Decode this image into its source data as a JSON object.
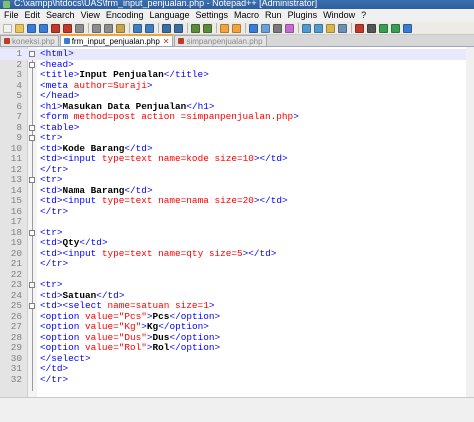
{
  "window": {
    "title": "C:\\xampp\\htdocs\\UAS\\frm_input_penjualan.php - Notepad++ [Administrator]"
  },
  "menu": [
    "File",
    "Edit",
    "Search",
    "View",
    "Encoding",
    "Language",
    "Settings",
    "Macro",
    "Run",
    "Plugins",
    "Window",
    "?"
  ],
  "toolbar": {
    "buttons": [
      "new-file-icon",
      "open-file-icon",
      "save-icon",
      "save-all-icon",
      "close-icon",
      "close-all-icon",
      "print-icon",
      "cut-icon",
      "copy-icon",
      "paste-icon",
      "undo-icon",
      "redo-icon",
      "find-icon",
      "replace-icon",
      "zoom-in-icon",
      "zoom-out-icon",
      "sync-v-icon",
      "sync-h-icon",
      "wrap-icon",
      "all-chars-icon",
      "indent-guide-icon",
      "udl-icon",
      "doc-map-icon",
      "function-list-icon",
      "folder-workspace-icon",
      "monitor-icon",
      "record-macro-icon",
      "stop-record-icon",
      "play-macro-icon",
      "run-macro-multiple-icon",
      "save-macro-icon"
    ],
    "colors": {
      "primary": "#3a7bd5",
      "accent": "#f2a33c",
      "danger": "#c0392b"
    }
  },
  "tabs": [
    {
      "label": "koneksi.php",
      "state": "inactive"
    },
    {
      "label": "frm_input_penjualan.php",
      "state": "active"
    },
    {
      "label": "simpanpenjualan.php",
      "state": "inactive"
    }
  ],
  "editor": {
    "current_line": 1,
    "lines": [
      {
        "n": "1",
        "code": "<html>"
      },
      {
        "n": "2",
        "code": "<head>"
      },
      {
        "n": "3",
        "code": "<title>Input Penjualan</title>"
      },
      {
        "n": "4",
        "code": "<meta author=Suraji>"
      },
      {
        "n": "5",
        "code": "</head>"
      },
      {
        "n": "6",
        "code": "<h1>Masukan Data Penjualan</h1>"
      },
      {
        "n": "7",
        "code": "<form method=post action =simpanpenjualan.php>"
      },
      {
        "n": "8",
        "code": "<table>"
      },
      {
        "n": "9",
        "code": "<tr>"
      },
      {
        "n": "10",
        "code": "<td>Kode Barang</td>"
      },
      {
        "n": "11",
        "code": "<td><input type=text name=kode size=10></td>"
      },
      {
        "n": "12",
        "code": "</tr>"
      },
      {
        "n": "13",
        "code": "<tr>"
      },
      {
        "n": "14",
        "code": "<td>Nama Barang</td>"
      },
      {
        "n": "15",
        "code": "<td><input type=text name=nama size=20></td>"
      },
      {
        "n": "16",
        "code": "</tr>"
      },
      {
        "n": "17",
        "code": ""
      },
      {
        "n": "18",
        "code": "<tr>"
      },
      {
        "n": "19",
        "code": "<td>Qty</td>"
      },
      {
        "n": "20",
        "code": "<td><input type=text name=qty size=5></td>"
      },
      {
        "n": "21",
        "code": "</tr>"
      },
      {
        "n": "22",
        "code": ""
      },
      {
        "n": "23",
        "code": "<tr>"
      },
      {
        "n": "24",
        "code": "<td>Satuan</td>"
      },
      {
        "n": "25",
        "code": "<td><select name=satuan size=1>"
      },
      {
        "n": "26",
        "code": "<option value=\"Pcs\">Pcs</option>"
      },
      {
        "n": "27",
        "code": "<option value=\"Kg\">Kg</option>"
      },
      {
        "n": "28",
        "code": "<option value=\"Dus\">Dus</option>"
      },
      {
        "n": "29",
        "code": "<option value=\"Rol\">Rol</option>"
      },
      {
        "n": "30",
        "code": "</select>"
      },
      {
        "n": "31",
        "code": "</td>"
      },
      {
        "n": "32",
        "code": "</tr>"
      }
    ]
  }
}
